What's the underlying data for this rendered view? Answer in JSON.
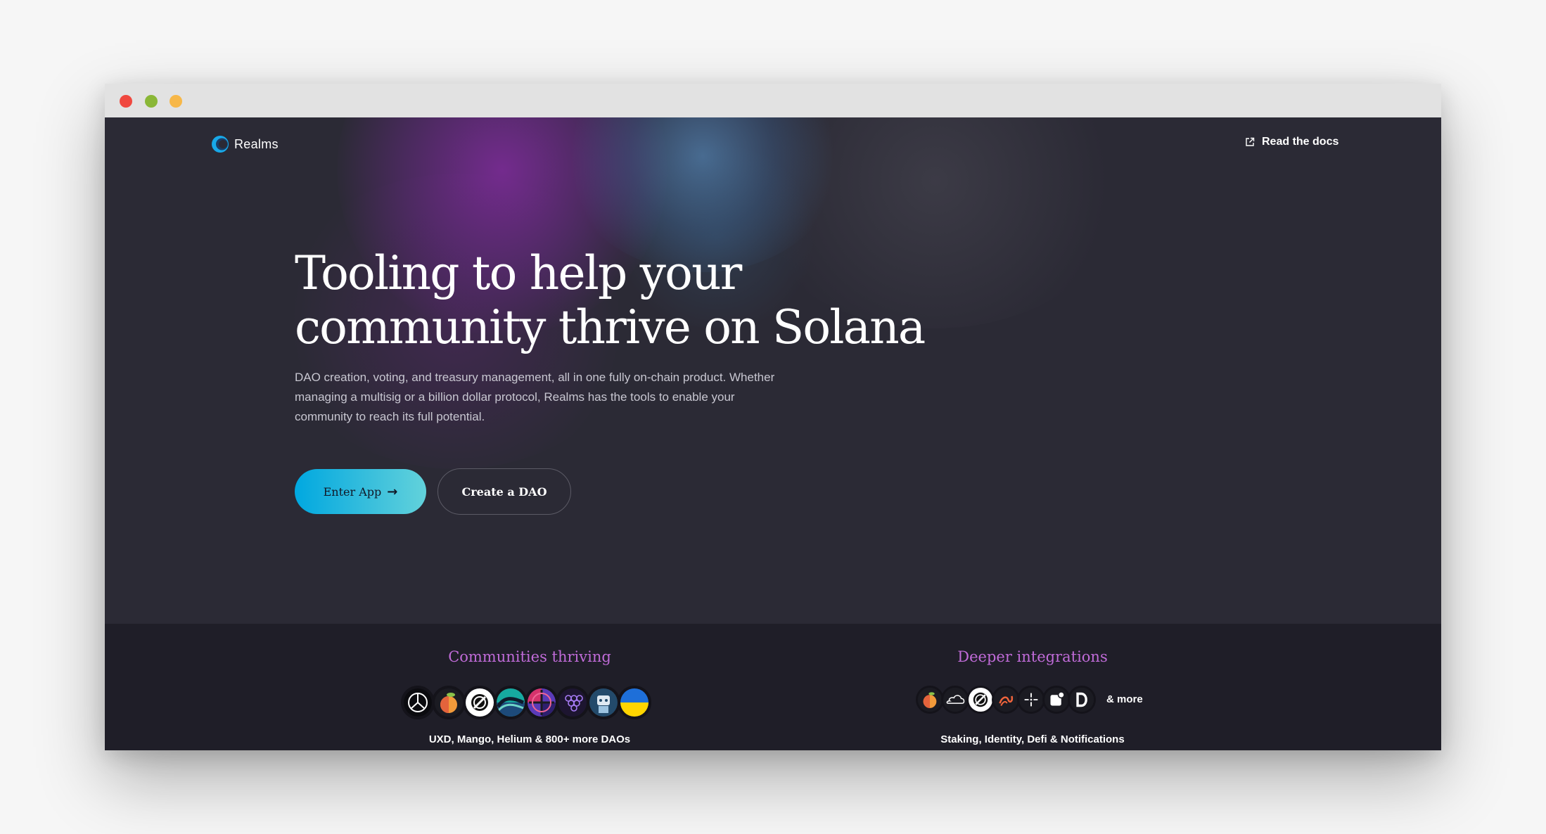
{
  "nav": {
    "brand": "Realms",
    "docs_link": "Read the docs"
  },
  "hero": {
    "title_line1": "Tooling to help your",
    "title_line2": "community thrive on Solana",
    "subtitle": "DAO creation, voting, and treasury management, all in one fully on-chain product. Whether managing a multisig or a billion dollar protocol, Realms has the tools to enable your community to reach its full potential.",
    "enter_app": "Enter App",
    "create_dao": "Create a DAO"
  },
  "communities": {
    "title": "Communities thriving",
    "caption": "UXD, Mango, Helium & 800+ more DAOs",
    "icons": [
      "uxd-icon",
      "mango-icon",
      "helium-icon",
      "wave-icon",
      "circle-cross-icon",
      "grape-icon",
      "robot-icon",
      "ukraine-flag-icon"
    ]
  },
  "integrations": {
    "title": "Deeper integrations",
    "caption": "Staking, Identity, Defi & Notifications",
    "more": "& more",
    "icons": [
      "mango-icon",
      "cloud-icon",
      "helium-icon",
      "swirl-icon",
      "sparkle-icon",
      "notification-icon",
      "d-letter-icon"
    ]
  },
  "colors": {
    "background": "#2b2a35",
    "band": "#1f1e28",
    "accent_purple": "#c06bd8",
    "button_gradient_start": "#00a8e0",
    "button_gradient_end": "#62d2db"
  }
}
